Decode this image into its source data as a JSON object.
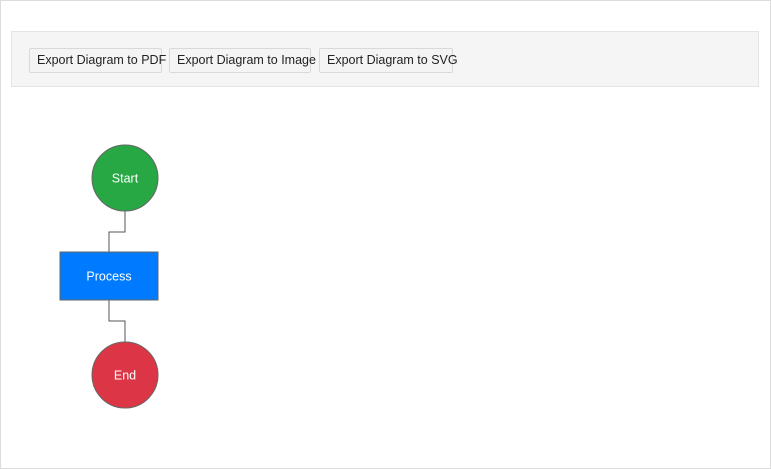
{
  "toolbar": {
    "buttons": [
      {
        "label": "Export Diagram to PDF"
      },
      {
        "label": "Export Diagram to Image"
      },
      {
        "label": "Export Diagram to SVG"
      }
    ]
  },
  "diagram": {
    "nodes": [
      {
        "id": "start",
        "label": "Start",
        "shape": "circle",
        "color": "#28a745"
      },
      {
        "id": "process",
        "label": "Process",
        "shape": "rectangle",
        "color": "#007bff"
      },
      {
        "id": "end",
        "label": "End",
        "shape": "circle",
        "color": "#dc3545"
      }
    ],
    "connectors": [
      {
        "from": "start",
        "to": "process"
      },
      {
        "from": "process",
        "to": "end"
      }
    ]
  }
}
